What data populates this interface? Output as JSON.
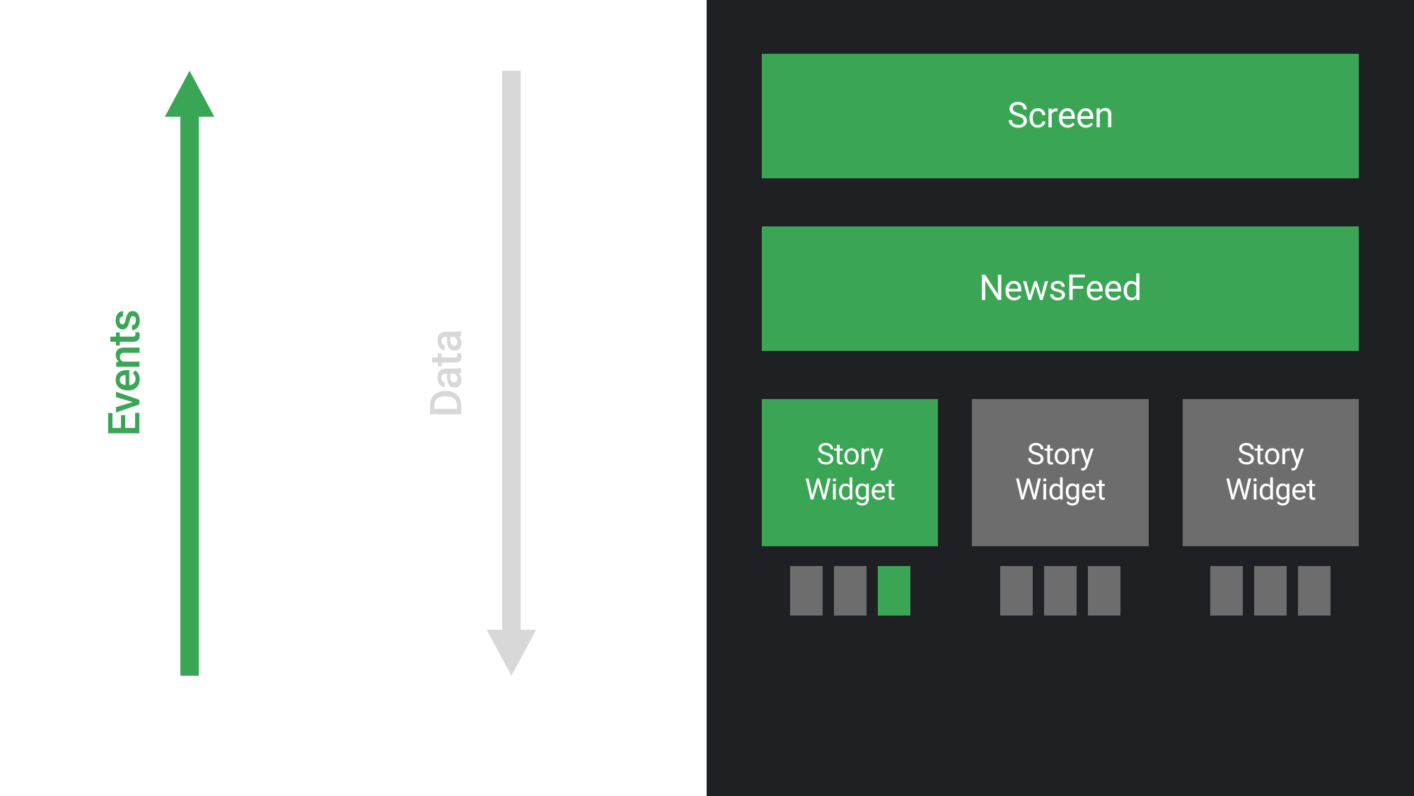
{
  "arrows": {
    "events": {
      "label": "Events",
      "color": "#3AA655",
      "direction": "up"
    },
    "data": {
      "label": "Data",
      "color": "#d8d8d8",
      "direction": "down"
    }
  },
  "hierarchy": {
    "screen": {
      "label": "Screen",
      "state": "active"
    },
    "newsfeed": {
      "label": "NewsFeed",
      "state": "active"
    },
    "widgets": [
      {
        "label": "Story\nWidget",
        "state": "active",
        "indicators": [
          "inactive",
          "inactive",
          "active"
        ]
      },
      {
        "label": "Story\nWidget",
        "state": "inactive",
        "indicators": [
          "inactive",
          "inactive",
          "inactive"
        ]
      },
      {
        "label": "Story\nWidget",
        "state": "inactive",
        "indicators": [
          "inactive",
          "inactive",
          "inactive"
        ]
      }
    ]
  },
  "colors": {
    "active": "#3AA655",
    "inactive": "#6d6d6d",
    "faded": "#d8d8d8",
    "darkBg": "#1f2023"
  }
}
